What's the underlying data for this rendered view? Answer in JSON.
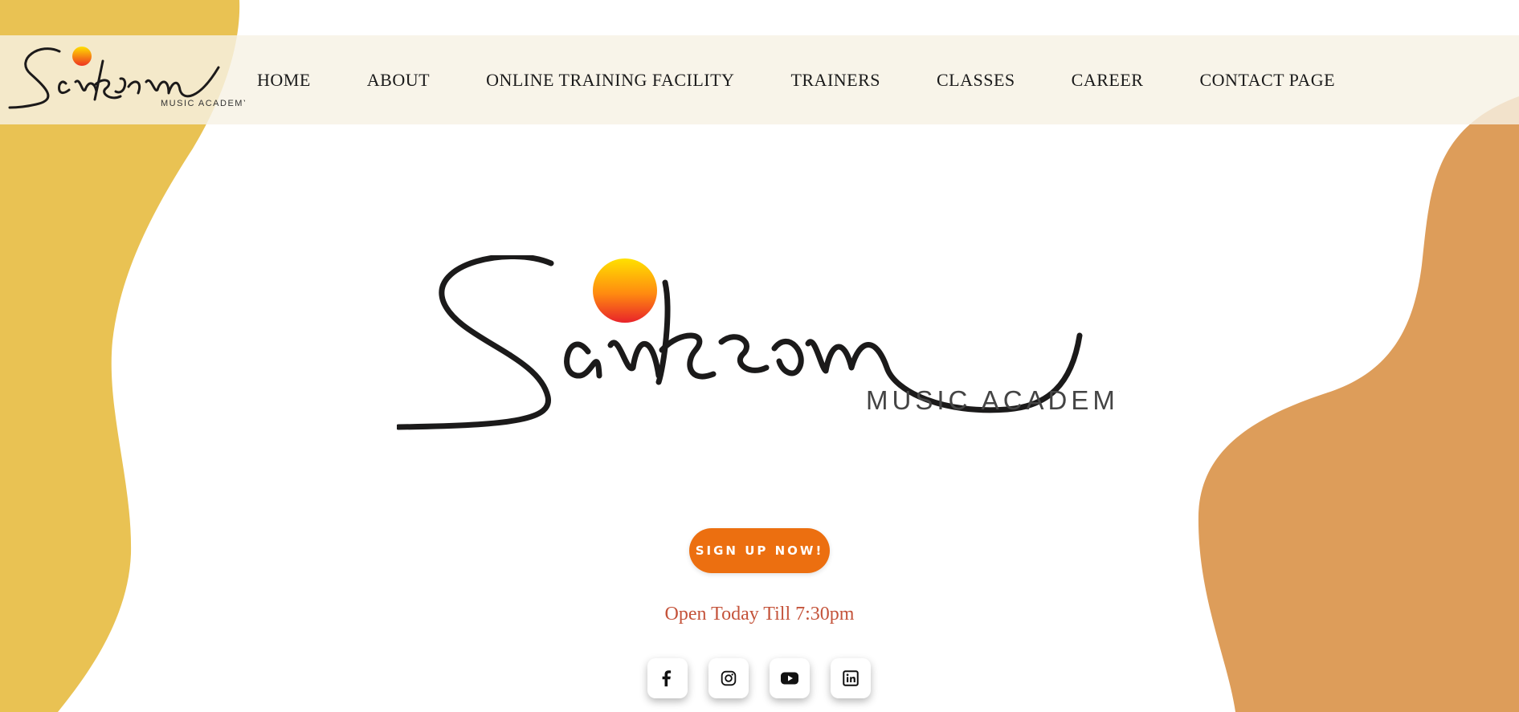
{
  "brand": {
    "wordmark": "Sankram",
    "tagline": "MUSIC ACADEMY"
  },
  "nav": {
    "items": [
      {
        "label": "HOME"
      },
      {
        "label": "ABOUT"
      },
      {
        "label": "ONLINE TRAINING FACILITY"
      },
      {
        "label": "TRAINERS"
      },
      {
        "label": "CLASSES"
      },
      {
        "label": "CAREER"
      },
      {
        "label": "CONTACT PAGE"
      }
    ]
  },
  "hero": {
    "cta_label": "SIGN UP NOW!",
    "hours_text": "Open Today Till 7:30pm"
  },
  "socials": [
    {
      "icon": "facebook-icon"
    },
    {
      "icon": "instagram-icon"
    },
    {
      "icon": "youtube-icon"
    },
    {
      "icon": "linkedin-icon"
    }
  ],
  "colors": {
    "left_blob": "#e9c253",
    "right_blob": "#dd9d5a",
    "cta_background": "#ec6f10",
    "hours_text": "#c4533a",
    "navbar_background": "#f6f2e4"
  }
}
